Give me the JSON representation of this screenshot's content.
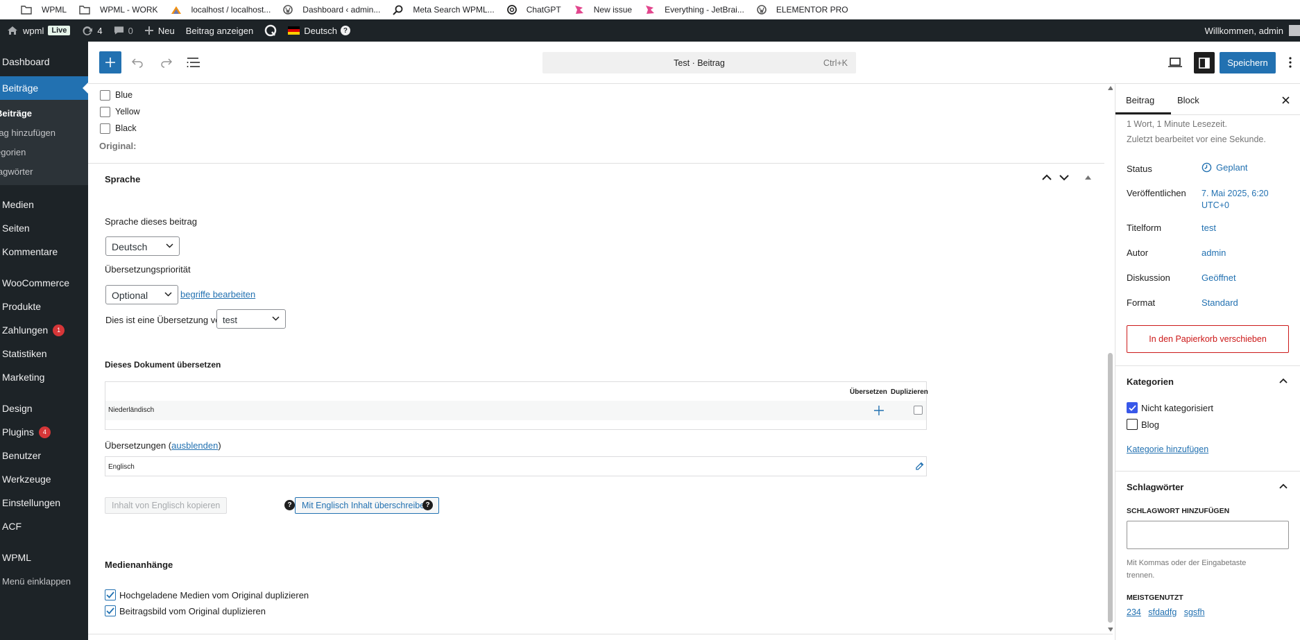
{
  "bookmarks": [
    {
      "label": "WPML",
      "icon": "folder-icon"
    },
    {
      "label": "WPML - WORK",
      "icon": "folder-icon"
    },
    {
      "label": "localhost / localhost...",
      "icon": "phpmyadmin-icon"
    },
    {
      "label": "Dashboard ‹ admin...",
      "icon": "wordpress-icon"
    },
    {
      "label": "Meta Search WPML...",
      "icon": "search-icon"
    },
    {
      "label": "ChatGPT",
      "icon": "chatgpt-icon"
    },
    {
      "label": "New issue",
      "icon": "jetbrains-icon"
    },
    {
      "label": "Everything - JetBrai...",
      "icon": "jetbrains-icon"
    },
    {
      "label": "ELEMENTOR PRO",
      "icon": "wordpress-icon"
    }
  ],
  "adminbar": {
    "site": "wpml",
    "live": "Live",
    "updates": "4",
    "comments": "0",
    "new": "Neu",
    "view": "Beitrag anzeigen",
    "language": "Deutsch",
    "language_help": "?",
    "welcome": "Willkommen, admin"
  },
  "sidebar": {
    "items_top": [
      {
        "label": "Dashboard"
      }
    ],
    "current": "Beiträge",
    "sub": [
      "Beiträge",
      "rag hinzufügen",
      "egorien",
      "lagwörter"
    ],
    "items": [
      {
        "label": "Medien"
      },
      {
        "label": "Seiten"
      },
      {
        "label": "Kommentare"
      },
      {
        "label": "WooCommerce"
      },
      {
        "label": "Produkte"
      },
      {
        "label": "Zahlungen",
        "badge": "1"
      },
      {
        "label": "Statistiken"
      },
      {
        "label": "Marketing"
      },
      {
        "label": "Design"
      },
      {
        "label": "Plugins",
        "badge": "4"
      },
      {
        "label": "Benutzer"
      },
      {
        "label": "Werkzeuge"
      },
      {
        "label": "Einstellungen"
      },
      {
        "label": "ACF"
      },
      {
        "label": "WPML"
      },
      {
        "label": "Menü einklappen"
      }
    ]
  },
  "toolbar": {
    "command_title": "Test · Beitrag",
    "shortcut": "Ctrl+K",
    "save": "Speichern"
  },
  "editor": {
    "colors": [
      "Blue",
      "Yellow",
      "Black"
    ],
    "original_label": "Original:",
    "lang_panel_title": "Sprache",
    "lang_of_post": "Sprache dieses beitrag",
    "lang_value": "Deutsch",
    "priority_label": "Übersetzungspriorität",
    "priority_value": "Optional",
    "edit_terms": "begriffe bearbeiten",
    "translation_of": "Dies ist eine Übersetzung von",
    "translation_of_value": "test",
    "translate_doc": "Dieses Dokument übersetzen",
    "col_translate": "Übersetzen",
    "col_duplicate": "Duplizieren",
    "dutch": "Niederländisch",
    "translations_label": "Übersetzungen (",
    "hide": "ausblenden",
    "translations_close": ")",
    "english": "Englisch",
    "copy_btn": "Inhalt von Englisch kopieren",
    "overwrite_btn": "Mit Englisch Inhalt überschreiben.",
    "media_title": "Medienanhänge",
    "media_dup": "Hochgeladene Medien vom Original duplizieren",
    "featured_dup": "Beitragsbild vom Original duplizieren"
  },
  "panel": {
    "tab_post": "Beitrag",
    "tab_block": "Block",
    "words": "1 Wort, 1 Minute Lesezeit.",
    "edited": "Zuletzt bearbeitet vor eine Sekunde.",
    "status_label": "Status",
    "status": "Geplant",
    "published_label": "Veröffentlichen",
    "published_1": "7. Mai 2025, 6:20",
    "published_2": "UTC+0",
    "template_label": "Titelform",
    "template": "test",
    "author_label": "Autor",
    "author": "admin",
    "discussion_label": "Diskussion",
    "discussion": "Geöffnet",
    "format_label": "Format",
    "format": "Standard",
    "trash": "In den Papierkorb verschieben",
    "categories_title": "Kategorien",
    "cat_1": "Nicht kategorisiert",
    "cat_2": "Blog",
    "add_cat": "Kategorie hinzufügen",
    "tags_title": "Schlagwörter",
    "add_tag": "SCHLAGWORT HINZUFÜGEN",
    "tag_hint_1": "Mit Kommas oder der Eingabetaste",
    "tag_hint_2": "trennen.",
    "most_used": "MEISTGENUTZT",
    "tag_1": "234",
    "tag_2": "sfdadfg",
    "tag_3": "sgsfh"
  },
  "colors": {
    "wp_blue": "#2271b1",
    "admin_dark": "#1d2327",
    "danger": "#cc1818"
  }
}
